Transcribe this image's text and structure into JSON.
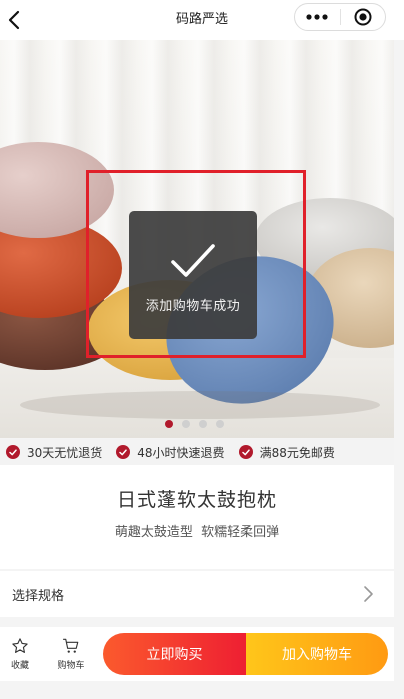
{
  "nav": {
    "title": "码路严选",
    "back_icon": "chevron-left-icon",
    "more_icon": "more-dots-icon",
    "close_icon": "record-circle-icon"
  },
  "hero": {
    "carousel": {
      "total": 4,
      "active_index": 0
    },
    "toast": {
      "icon": "checkmark-icon",
      "text": "添加购物车成功"
    }
  },
  "guarantees": [
    {
      "icon": "check-circle-icon",
      "text": "30天无忧退货"
    },
    {
      "icon": "check-circle-icon",
      "text": "48小时快速退费"
    },
    {
      "icon": "check-circle-icon",
      "text": "满88元免邮费"
    }
  ],
  "product": {
    "title": "日式蓬软太鼓抱枕",
    "subtitle": "萌趣太鼓造型  软糯轻柔回弹"
  },
  "spec": {
    "label": "选择规格",
    "arrow_icon": "chevron-right-icon"
  },
  "bottom_bar": {
    "favorite_label": "收藏",
    "favorite_icon": "star-icon",
    "cart_label": "购物车",
    "cart_icon": "cart-icon",
    "buy_now_label": "立即购买",
    "add_to_cart_label": "加入购物车"
  },
  "colors": {
    "accent_red": "#b1192c",
    "highlight_red": "#e0202a",
    "buy_gradient": [
      "#fb5a2d",
      "#ee1f32"
    ],
    "cart_gradient": [
      "#ffc61a",
      "#ff9a12"
    ]
  }
}
